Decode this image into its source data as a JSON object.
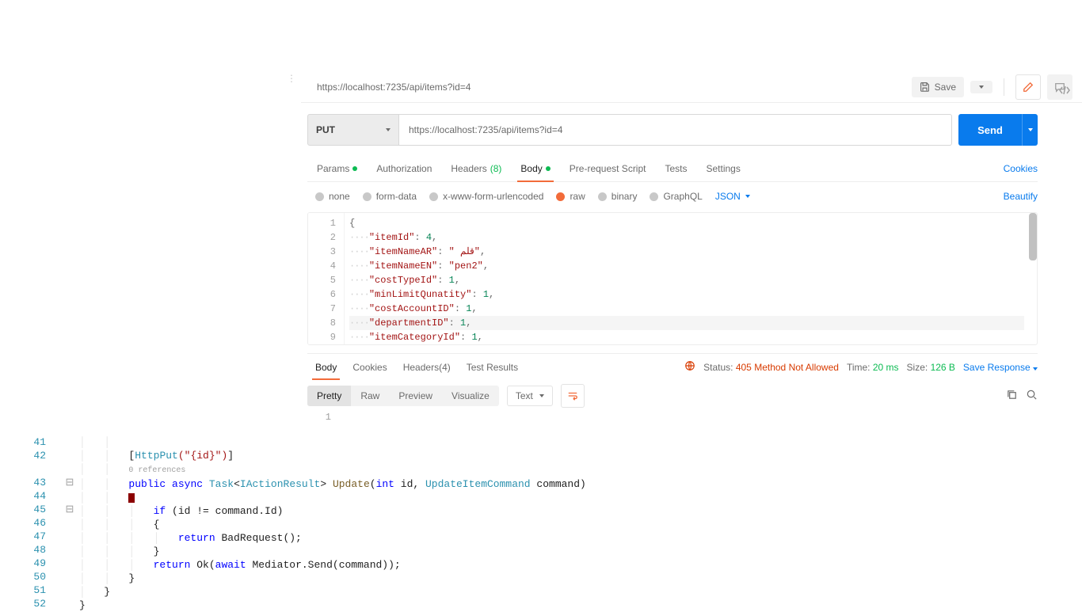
{
  "header": {
    "title": "https://localhost:7235/api/items?id=4",
    "save": "Save"
  },
  "request": {
    "method": "PUT",
    "url": "https://localhost:7235/api/items?id=4",
    "send": "Send"
  },
  "tabs": {
    "params": "Params",
    "auth": "Authorization",
    "headers": "Headers",
    "headers_count": "(8)",
    "body": "Body",
    "prereq": "Pre-request Script",
    "tests": "Tests",
    "settings": "Settings",
    "cookies": "Cookies"
  },
  "bodytype": {
    "none": "none",
    "form": "form-data",
    "urlenc": "x-www-form-urlencoded",
    "raw": "raw",
    "binary": "binary",
    "graphql": "GraphQL",
    "fmt": "JSON",
    "beautify": "Beautify"
  },
  "editor_lines": [
    "1",
    "2",
    "3",
    "4",
    "5",
    "6",
    "7",
    "8",
    "9"
  ],
  "json_body": {
    "l1": "{",
    "l2k": "\"itemId\"",
    "l2v": "4",
    "l3k": "\"itemNameAR\"",
    "l3v": "\" قلم\"",
    "l4k": "\"itemNameEN\"",
    "l4v": "\"pen2\"",
    "l5k": "\"costTypeId\"",
    "l5v": "1",
    "l6k": "\"minLimitQunatity\"",
    "l6v": "1",
    "l7k": "\"costAccountID\"",
    "l7v": "1",
    "l8k": "\"departmentID\"",
    "l8v": "1",
    "l9k": "\"itemCategoryId\"",
    "l9v": "1"
  },
  "response": {
    "tabs": {
      "body": "Body",
      "cookies": "Cookies",
      "headers": "Headers",
      "headers_count": "(4)",
      "tests": "Test Results"
    },
    "status_label": "Status:",
    "status_code": "405",
    "status_text": "Method Not Allowed",
    "time_label": "Time:",
    "time": "20 ms",
    "size_label": "Size:",
    "size": "126 B",
    "save": "Save Response"
  },
  "respview": {
    "pretty": "Pretty",
    "raw": "Raw",
    "preview": "Preview",
    "visualize": "Visualize",
    "fmt": "Text"
  },
  "resp_line1": "1",
  "vs": {
    "lines": [
      "41",
      "42",
      "",
      "43",
      "44",
      "45",
      "46",
      "47",
      "48",
      "49",
      "50",
      "51",
      "52"
    ],
    "refs": "0 references",
    "attr_open": "[",
    "attr_name": "HttpPut",
    "attr_arg": "(\"{id}\")",
    "attr_close": "]",
    "sig1": "public",
    "sig2": "async",
    "sig3": "Task",
    "sig4": "<",
    "sig5": "IActionResult",
    "sig6": "> ",
    "sig7": "Update",
    "sig8": "(",
    "sig9": "int",
    "sig10": " id, ",
    "sig11": "UpdateItemCommand",
    "sig12": " command)",
    "if1": "if",
    "if2": " (id != command.Id)",
    "lbrace": "{",
    "rbrace": "}",
    "ret1": "return",
    "ret2": " BadRequest();",
    "ret3": "return",
    "ret3b": " Ok(",
    "ret4": "await",
    "ret5": " Mediator.Send(command));",
    "rbrace2": "}",
    "rbrace3": "}",
    "rbrace4": "}"
  }
}
